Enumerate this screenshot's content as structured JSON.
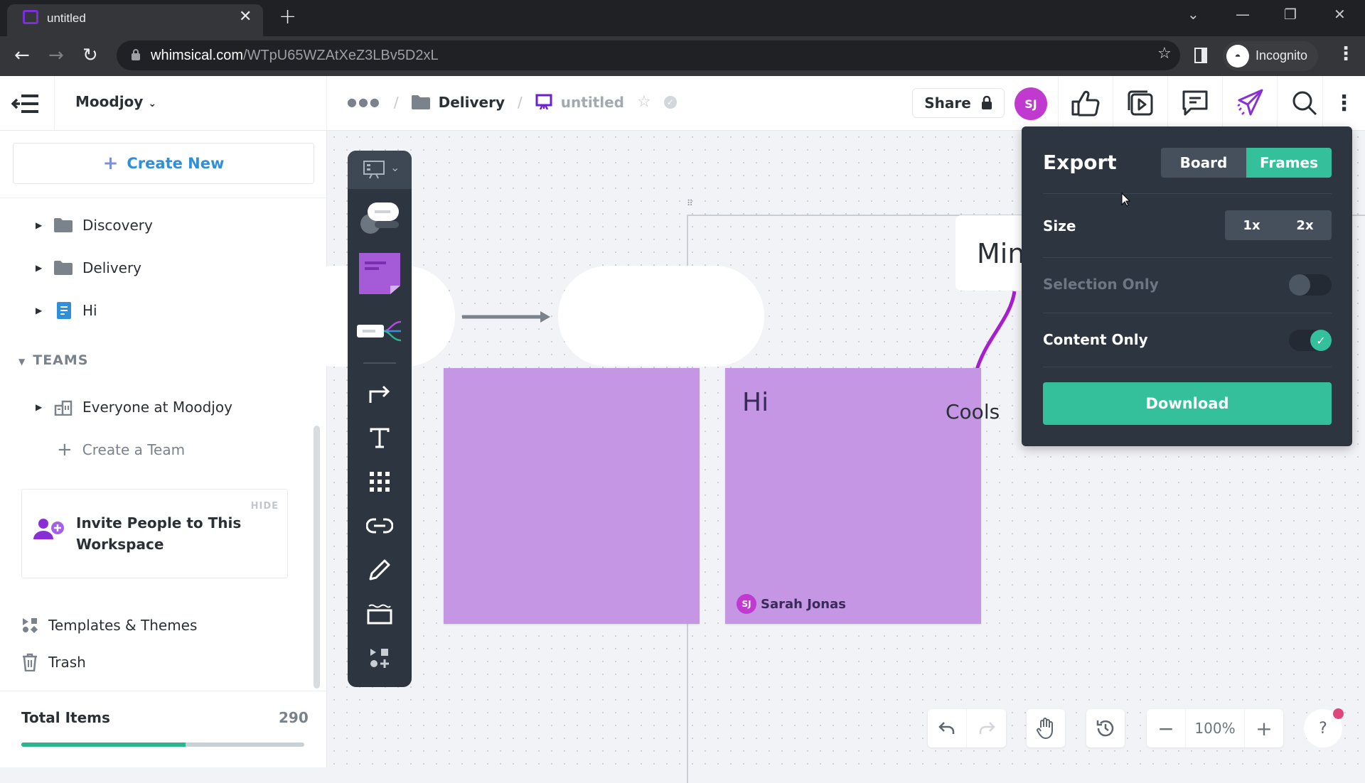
{
  "browser": {
    "tab_title": "untitled",
    "url_domain": "whimsical.com",
    "url_path": "/WTpU65WZAtXeZ3LBv5D2xL",
    "profile_label": "Incognito"
  },
  "header": {
    "workspace": "Moodjoy",
    "breadcrumb": [
      {
        "label": "Delivery",
        "icon": "folder-icon"
      },
      {
        "label": "untitled",
        "icon": "board-icon"
      }
    ],
    "share_label": "Share",
    "avatar_initials": "SJ",
    "icons": [
      "thumbs-up-icon",
      "presentation-icon",
      "comment-icon",
      "send-icon",
      "search-icon",
      "more-vertical-icon"
    ]
  },
  "sidebar": {
    "create_new": "Create New",
    "items": [
      {
        "label": "Discovery",
        "icon": "folder-icon"
      },
      {
        "label": "Delivery",
        "icon": "folder-icon"
      },
      {
        "label": "Hi",
        "icon": "document-icon"
      }
    ],
    "teams_heading": "TEAMS",
    "teams": [
      {
        "label": "Everyone at Moodjoy",
        "icon": "building-icon"
      }
    ],
    "create_team": "Create a Team",
    "invite": {
      "hide_label": "HIDE",
      "text": "Invite People to This Workspace"
    },
    "templates": "Templates & Themes",
    "trash": "Trash",
    "total_items_label": "Total Items",
    "total_items_value": "290",
    "usage_fraction": 0.58
  },
  "canvas": {
    "mini_card_text": "Min",
    "sticky_text": "Hi",
    "connector_label": "Cools",
    "sticky_author_initials": "SJ",
    "sticky_author": "Sarah Jonas"
  },
  "export": {
    "title": "Export",
    "scope_options": [
      "Board",
      "Frames"
    ],
    "scope_selected": "Frames",
    "size_label": "Size",
    "size_options": [
      "1x",
      "2x"
    ],
    "selection_only_label": "Selection Only",
    "selection_only": false,
    "content_only_label": "Content Only",
    "content_only": true,
    "download_label": "Download"
  },
  "controls": {
    "zoom_level": "100%",
    "help_label": "?"
  },
  "colors": {
    "accent_green": "#35c09c",
    "sticky_purple": "#c496e3",
    "avatar_magenta": "#c03ad0",
    "panel_dark": "#2d3540"
  }
}
